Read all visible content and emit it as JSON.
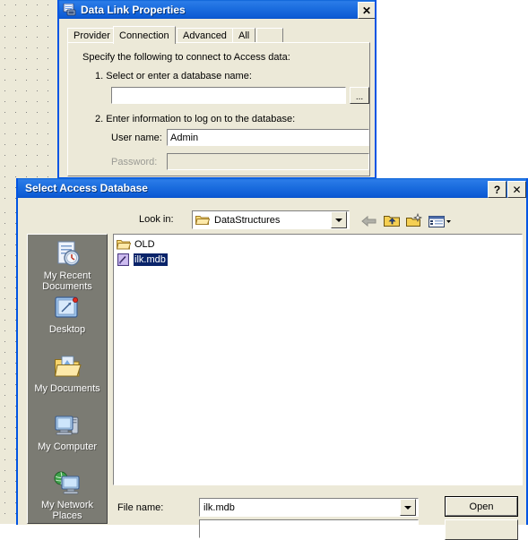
{
  "designer": {
    "background_color": "#ece9d8",
    "grid_dot_color": "#808080"
  },
  "theme": {
    "titlebar_blue": "#0a5ad4",
    "face": "#ece9d8",
    "selection_blue": "#0a246a",
    "places_bar_gray": "#7b7b73"
  },
  "data_link_properties": {
    "title": "Data Link Properties",
    "title_icon": "data-link-icon",
    "close_label": "✕",
    "tabs": [
      {
        "label": "Provider",
        "selected": false
      },
      {
        "label": "Connection",
        "selected": true
      },
      {
        "label": "Advanced",
        "selected": false
      },
      {
        "label": "All",
        "selected": false
      }
    ],
    "intro_text": "Specify the following to connect to Access data:",
    "step1_label": "1. Select or enter a database name:",
    "database_name_value": "",
    "database_name_placeholder": "",
    "browse_label": "...",
    "step2_label": "2. Enter information to log on to the database:",
    "user_name_label": "User name:",
    "user_name_value": "Admin",
    "password_label": "Password:",
    "password_value": ""
  },
  "select_access_database": {
    "title": "Select Access Database",
    "help_label": "?",
    "close_label": "✕",
    "look_in_label": "Look in:",
    "look_in_value": "DataStructures",
    "toolbar": [
      {
        "name": "back-button",
        "icon": "back-arrow-icon",
        "enabled": false
      },
      {
        "name": "up-one-level-button",
        "icon": "up-folder-icon",
        "enabled": true
      },
      {
        "name": "create-new-folder-button",
        "icon": "new-folder-icon",
        "enabled": true
      },
      {
        "name": "views-button",
        "icon": "views-icon",
        "enabled": true
      }
    ],
    "places": [
      {
        "label": "My Recent Documents",
        "icon": "recent-documents-icon"
      },
      {
        "label": "Desktop",
        "icon": "desktop-icon"
      },
      {
        "label": "My Documents",
        "icon": "my-documents-icon"
      },
      {
        "label": "My Computer",
        "icon": "my-computer-icon"
      },
      {
        "label": "My Network Places",
        "icon": "network-places-icon"
      }
    ],
    "files": [
      {
        "name": "OLD",
        "icon": "folder-icon",
        "selected": false
      },
      {
        "name": "ilk.mdb",
        "icon": "access-database-icon",
        "selected": true
      }
    ],
    "file_name_label": "File name:",
    "file_name_value": "ilk.mdb",
    "open_label": "Open",
    "files_of_type_value": "",
    "cancel_label": ""
  }
}
